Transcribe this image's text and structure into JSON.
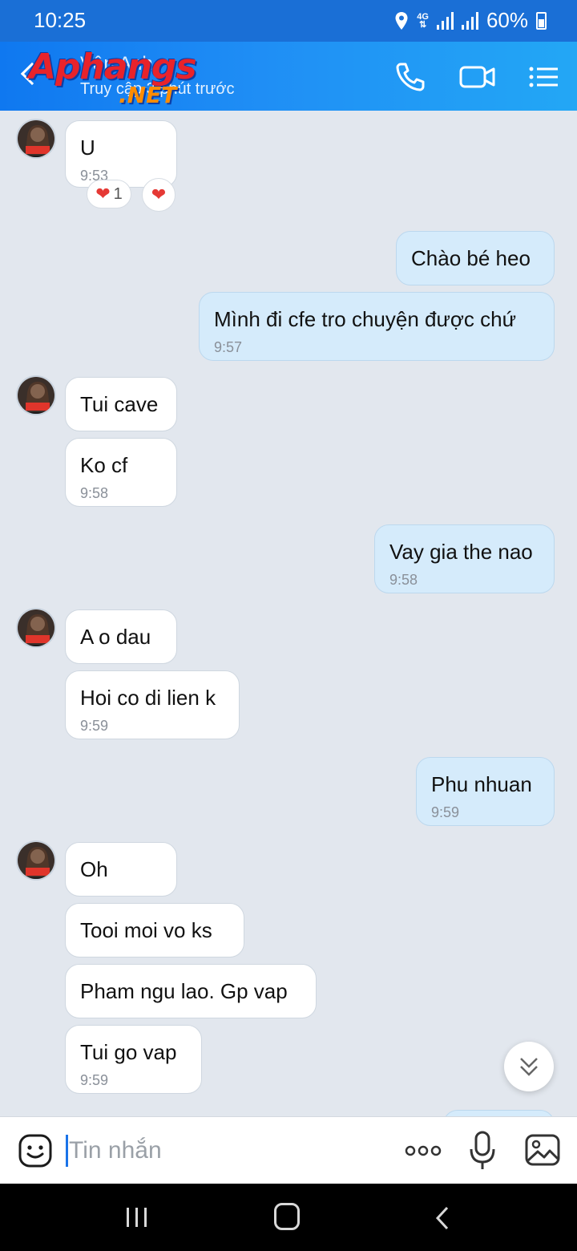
{
  "status_bar": {
    "time": "10:25",
    "network": "4G",
    "battery": "60%"
  },
  "header": {
    "contact_name": "Vân Anh",
    "last_seen": "Truy cập 3 phút trước",
    "watermark_main": "Aphangs",
    "watermark_net": ".NET"
  },
  "messages": [
    {
      "side": "in",
      "text": "U",
      "time": "9:53",
      "reactions": [
        "❤️ 1",
        "❤️"
      ]
    },
    {
      "side": "out",
      "text": "Chào bé heo"
    },
    {
      "side": "out",
      "text": "Mình đi cfe tro chuyện được chứ",
      "time": "9:57"
    },
    {
      "side": "in",
      "text": "Tui cave"
    },
    {
      "side": "in",
      "text": " Ko cf",
      "time": "9:58"
    },
    {
      "side": "out",
      "text": "Vay gia the nao",
      "time": "9:58"
    },
    {
      "side": "in",
      "text": "A o dau"
    },
    {
      "side": "in",
      "text": "Hoi co di lien k",
      "time": "9:59"
    },
    {
      "side": "out",
      "text": "Phu nhuan",
      "time": "9:59"
    },
    {
      "side": "in",
      "text": "Oh"
    },
    {
      "side": "in",
      "text": " Tooi moi vo ks"
    },
    {
      "side": "in",
      "text": " Pham ngu lao. Gp vap"
    },
    {
      "side": "in",
      "text": " Tui go vap",
      "time": "9:59"
    }
  ],
  "input": {
    "placeholder": "Tin nhắn"
  },
  "icons": {
    "emoji": "emoji-icon",
    "more": "more-icon",
    "mic": "microphone-icon",
    "image": "image-icon",
    "call": "phone-icon",
    "video": "video-camera-icon",
    "menu": "list-menu-icon"
  },
  "colors": {
    "header": "#1f8ef5",
    "outgoing_bubble": "#d5ebfb",
    "incoming_bubble": "#ffffff",
    "background": "#e2e7ee"
  }
}
